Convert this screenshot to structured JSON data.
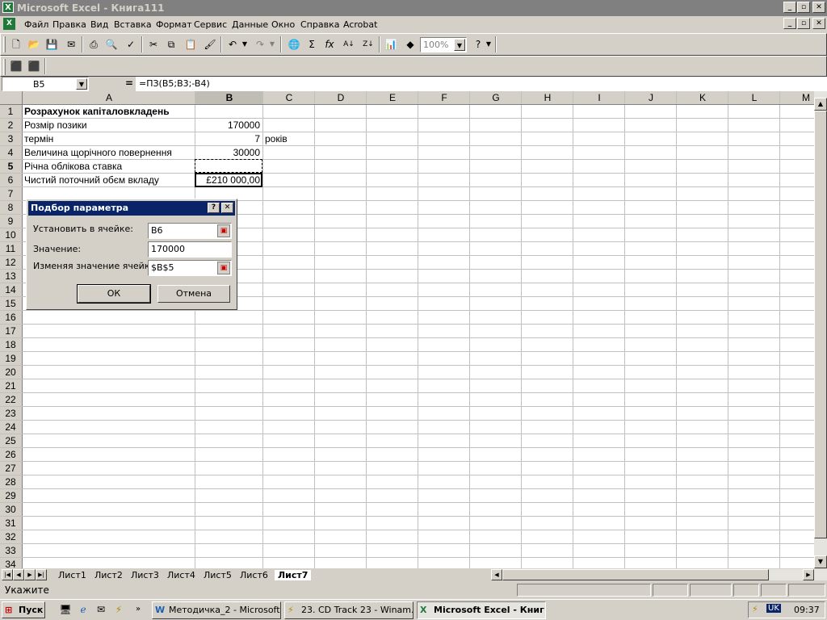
{
  "window": {
    "title": "Microsoft Excel - Книга111",
    "app_icon": "excel-icon"
  },
  "menu": {
    "items": [
      "Файл",
      "Правка",
      "Вид",
      "Вставка",
      "Формат",
      "Сервис",
      "Данные",
      "Окно",
      "Справка",
      "Acrobat"
    ]
  },
  "toolbar": {
    "zoom": "100%"
  },
  "formula_bar": {
    "name_box": "B5",
    "equals": "=",
    "formula": "=ПЗ(B5;B3;-B4)"
  },
  "grid": {
    "columns": [
      "A",
      "B",
      "C",
      "D",
      "E",
      "F",
      "G",
      "H",
      "I",
      "J",
      "K",
      "L",
      "M"
    ],
    "rows": [
      "1",
      "2",
      "3",
      "4",
      "5",
      "6",
      "7",
      "8",
      "9",
      "10",
      "11",
      "12",
      "13",
      "14",
      "15",
      "16",
      "17",
      "18",
      "19",
      "20",
      "21",
      "22",
      "23",
      "24",
      "25",
      "26",
      "27",
      "28",
      "29",
      "30",
      "31",
      "32",
      "33",
      "34"
    ],
    "cells": {
      "A1": "Розрахунок капіталовкладень",
      "A2": "Розмір позики",
      "B2": "170000",
      "A3": "термін",
      "B3": "7",
      "C3": "років",
      "A4": "Величина щорічного повернення",
      "B4": "30000",
      "A5": "Річна облікова ставка",
      "A6": "Чистий поточний обєм вкладу",
      "B6": "£210 000,00"
    }
  },
  "dialog": {
    "title": "Подбор параметра",
    "set_cell_label": "Установить в ячейке:",
    "set_cell_value": "B6",
    "value_label": "Значение:",
    "value_value": "170000",
    "changing_label": "Изменяя значение ячейки:",
    "changing_value": "$B$5",
    "ok": "ОК",
    "cancel": "Отмена"
  },
  "sheets": {
    "tabs": [
      "Лист1",
      "Лист2",
      "Лист3",
      "Лист4",
      "Лист5",
      "Лист6",
      "Лист7"
    ],
    "active": "Лист7"
  },
  "status": {
    "text": "Укажите"
  },
  "taskbar": {
    "start": "Пуск",
    "tasks": [
      "Методичка_2 - Microsoft...",
      "23. CD Track 23 - Winam...",
      "Microsoft Excel - Книг..."
    ],
    "lang": "UK",
    "clock": "09:37"
  },
  "colors": {
    "title_inactive": "#808080",
    "dialog_title": "#0a246a",
    "face": "#d4d0c8"
  }
}
